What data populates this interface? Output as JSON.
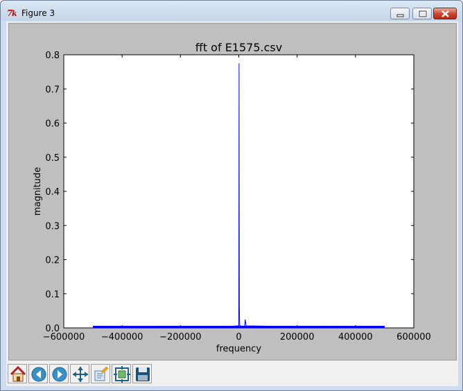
{
  "window": {
    "title": "Figure 3",
    "controls": [
      "minimize",
      "maximize",
      "close"
    ]
  },
  "toolbar": {
    "buttons": [
      {
        "name": "home",
        "icon": "home-icon"
      },
      {
        "name": "back",
        "icon": "arrow-left-icon"
      },
      {
        "name": "forward",
        "icon": "arrow-right-icon"
      },
      {
        "name": "pan",
        "icon": "move-icon"
      },
      {
        "name": "zoom",
        "icon": "zoom-rect-icon"
      },
      {
        "name": "configure-subplots",
        "icon": "subplots-icon"
      },
      {
        "name": "save",
        "icon": "floppy-disk-icon"
      }
    ]
  },
  "chart_data": {
    "type": "line",
    "title": "fft of E1575.csv",
    "xlabel": "frequency",
    "ylabel": "magnitude",
    "xlim": [
      -600000,
      600000
    ],
    "ylim": [
      0,
      0.8
    ],
    "xticks": [
      "−600000",
      "−400000",
      "−200000",
      "0",
      "200000",
      "400000",
      "600000"
    ],
    "yticks": [
      "0.0",
      "0.1",
      "0.2",
      "0.3",
      "0.4",
      "0.5",
      "0.6",
      "0.7",
      "0.8"
    ],
    "grid": false,
    "series": [
      {
        "color": "#0000ff",
        "x": [
          -500000,
          -400000,
          -300000,
          -200000,
          -100000,
          -20000,
          -5000,
          0,
          1000,
          2000,
          3000,
          5000,
          15000,
          20000,
          22000,
          25000,
          100000,
          200000,
          300000,
          400000,
          500000
        ],
        "y": [
          0.005,
          0.004,
          0.004,
          0.005,
          0.004,
          0.005,
          0.006,
          0.006,
          0.775,
          0.065,
          0.008,
          0.006,
          0.005,
          0.006,
          0.025,
          0.006,
          0.005,
          0.004,
          0.005,
          0.004,
          0.005
        ]
      }
    ]
  }
}
